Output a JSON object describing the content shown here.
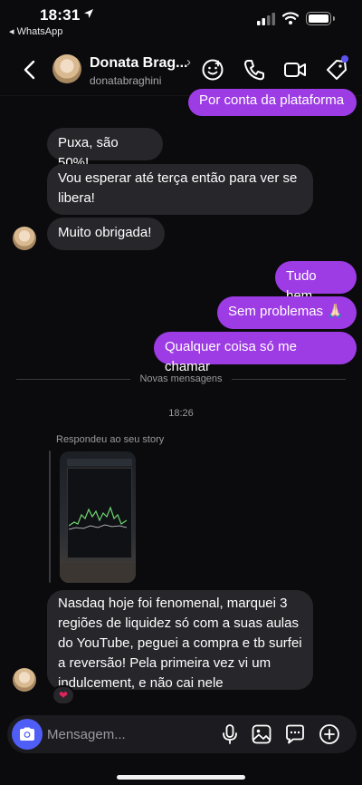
{
  "status_bar": {
    "time": "18:31",
    "back_app": "◂ WhatsApp"
  },
  "header": {
    "name": "Donata Brag...",
    "chevron": "›",
    "username": "donatabraghini",
    "icons": [
      "sticker-icon",
      "phone-icon",
      "video-icon",
      "tag-icon"
    ]
  },
  "messages": [
    {
      "from": "me",
      "text": "Por conta da plataforma"
    },
    {
      "from": "them",
      "text": "Puxa, são 50%!"
    },
    {
      "from": "them",
      "text": "Vou esperar até terça então para ver se libera!"
    },
    {
      "from": "them",
      "text": "Muito obrigada!"
    },
    {
      "from": "me",
      "text": "Tudo bem"
    },
    {
      "from": "me",
      "text": "Sem problemas 🙏🏻"
    },
    {
      "from": "me",
      "text": "Qualquer coisa só me chamar"
    }
  ],
  "new_messages_label": "Novas mensagens",
  "timestamp": "18:26",
  "story_reply": {
    "label": "Respondeu ao seu story",
    "message": "Nasdaq hoje foi fenomenal, marquei 3 regiões de liquidez só com a suas aulas do YouTube, peguei a compra e tb surfei a reversão! Pela primeira vez vi um indulcement, e não cai nele",
    "reaction": "❤"
  },
  "composer": {
    "placeholder": "Mensagem..."
  },
  "colors": {
    "outgoing": "#9d3ce4",
    "incoming": "#26262b",
    "camera": "#4f5ef7",
    "background": "#0b0b0d"
  }
}
